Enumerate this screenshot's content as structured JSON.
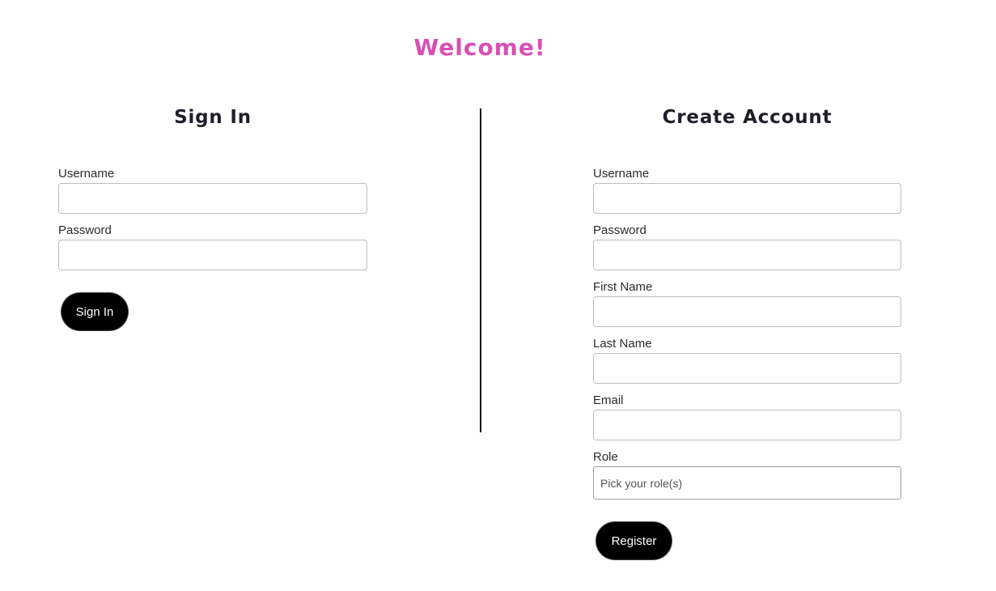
{
  "page": {
    "heading": "Welcome!",
    "accent_color": "#d94fb3"
  },
  "sign_in": {
    "title": "Sign In",
    "username_label": "Username",
    "username_value": "",
    "password_label": "Password",
    "password_value": "",
    "submit_label": "Sign In"
  },
  "create_account": {
    "title": "Create Account",
    "username_label": "Username",
    "username_value": "",
    "password_label": "Password",
    "password_value": "",
    "first_name_label": "First Name",
    "first_name_value": "",
    "last_name_label": "Last Name",
    "last_name_value": "",
    "email_label": "Email",
    "email_value": "",
    "role_label": "Role",
    "role_placeholder": "Pick your role(s)",
    "submit_label": "Register"
  }
}
